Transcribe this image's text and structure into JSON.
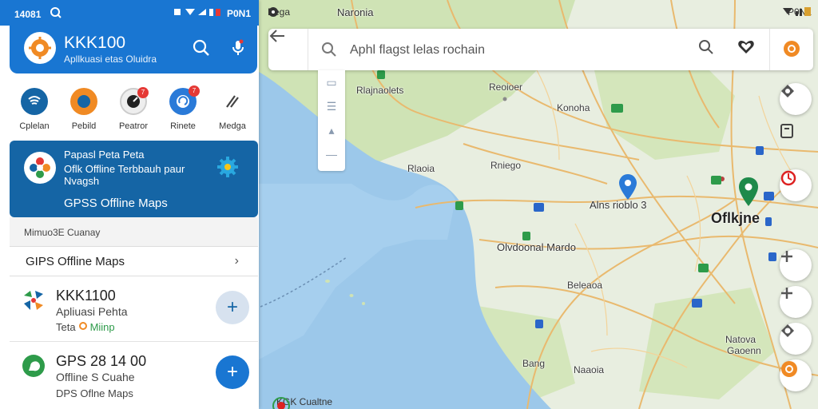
{
  "phone_status": {
    "time": "14081",
    "right_time": "P0N1"
  },
  "header": {
    "title": "KKK100",
    "subtitle": "Apllkuasi etas Oluidra"
  },
  "quick_actions": [
    {
      "label": "Cplelan",
      "badge": ""
    },
    {
      "label": "Pebild",
      "badge": ""
    },
    {
      "label": "Peatror",
      "badge": "7"
    },
    {
      "label": "Rinete",
      "badge": "7"
    },
    {
      "label": "Medga",
      "badge": ""
    }
  ],
  "promo": {
    "line1": "Papasl Peta Peta",
    "line2": "Oflk Offline Terbbauh paur Nvagsh",
    "line3": "GPSS Offline Maps"
  },
  "section": {
    "label": "Mimuo3E Cuanay"
  },
  "row_link": {
    "label": "GIPS Offline Maps"
  },
  "apps": [
    {
      "name": "KKK1100",
      "sub1": "Apliuasi Pehta",
      "sub2_a": "Teta",
      "sub2_b": "Miinp"
    },
    {
      "name": "GPS 28 14 00",
      "sub1": "Offline S Cuahe",
      "sub2": "DPS Oflne Maps"
    }
  ],
  "map_status": {
    "left": "Bega",
    "right": "P0N1"
  },
  "search": {
    "placeholder": "Aphl flagst lelas rochain"
  },
  "map_labels": {
    "top_center": "Naronia",
    "l1": "Rlajnaolets",
    "l2": "Reoioer",
    "l3": "Konoha",
    "l4": "Rlaoia",
    "l5": "Rniego",
    "l6": "Alns rioblo 3",
    "l7": "Oflkjne",
    "l8": "Olvdoonal Mardo",
    "l9": "Beleaoa",
    "l10": "Natova",
    "l11": "Gaoenn",
    "l12": "Bang",
    "l13": "Naaoia"
  },
  "attrib": {
    "label": "KGK Cualtne"
  },
  "colors": {
    "primary": "#1976d2",
    "promo": "#1565a5",
    "water": "#9cc8ea",
    "land": "#e8eee0",
    "green": "#bcd9a0",
    "road": "#e9b96e"
  }
}
